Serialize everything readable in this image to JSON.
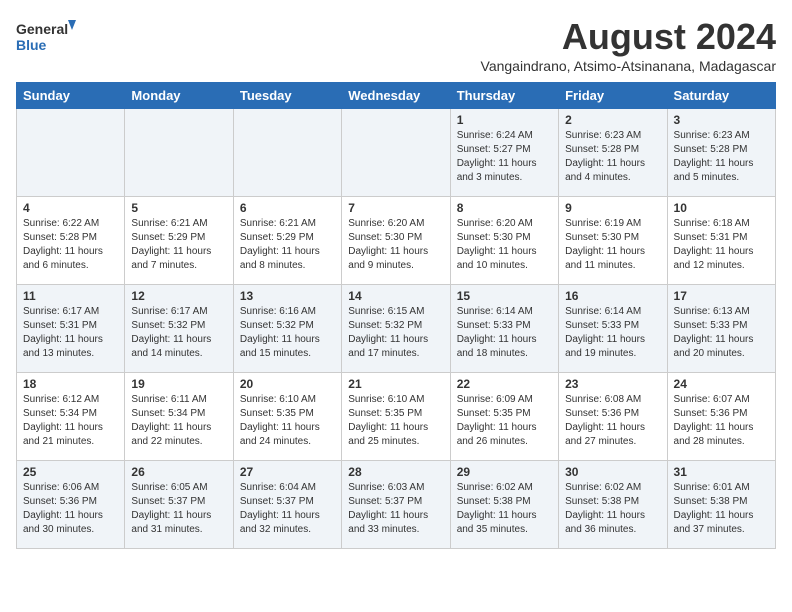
{
  "logo": {
    "general": "General",
    "blue": "Blue"
  },
  "header": {
    "month_year": "August 2024",
    "location": "Vangaindrano, Atsimo-Atsinanana, Madagascar"
  },
  "days_of_week": [
    "Sunday",
    "Monday",
    "Tuesday",
    "Wednesday",
    "Thursday",
    "Friday",
    "Saturday"
  ],
  "weeks": [
    [
      {
        "day": "",
        "sunrise": "",
        "sunset": "",
        "daylight": ""
      },
      {
        "day": "",
        "sunrise": "",
        "sunset": "",
        "daylight": ""
      },
      {
        "day": "",
        "sunrise": "",
        "sunset": "",
        "daylight": ""
      },
      {
        "day": "",
        "sunrise": "",
        "sunset": "",
        "daylight": ""
      },
      {
        "day": "1",
        "sunrise": "Sunrise: 6:24 AM",
        "sunset": "Sunset: 5:27 PM",
        "daylight": "Daylight: 11 hours and 3 minutes."
      },
      {
        "day": "2",
        "sunrise": "Sunrise: 6:23 AM",
        "sunset": "Sunset: 5:28 PM",
        "daylight": "Daylight: 11 hours and 4 minutes."
      },
      {
        "day": "3",
        "sunrise": "Sunrise: 6:23 AM",
        "sunset": "Sunset: 5:28 PM",
        "daylight": "Daylight: 11 hours and 5 minutes."
      }
    ],
    [
      {
        "day": "4",
        "sunrise": "Sunrise: 6:22 AM",
        "sunset": "Sunset: 5:28 PM",
        "daylight": "Daylight: 11 hours and 6 minutes."
      },
      {
        "day": "5",
        "sunrise": "Sunrise: 6:21 AM",
        "sunset": "Sunset: 5:29 PM",
        "daylight": "Daylight: 11 hours and 7 minutes."
      },
      {
        "day": "6",
        "sunrise": "Sunrise: 6:21 AM",
        "sunset": "Sunset: 5:29 PM",
        "daylight": "Daylight: 11 hours and 8 minutes."
      },
      {
        "day": "7",
        "sunrise": "Sunrise: 6:20 AM",
        "sunset": "Sunset: 5:30 PM",
        "daylight": "Daylight: 11 hours and 9 minutes."
      },
      {
        "day": "8",
        "sunrise": "Sunrise: 6:20 AM",
        "sunset": "Sunset: 5:30 PM",
        "daylight": "Daylight: 11 hours and 10 minutes."
      },
      {
        "day": "9",
        "sunrise": "Sunrise: 6:19 AM",
        "sunset": "Sunset: 5:30 PM",
        "daylight": "Daylight: 11 hours and 11 minutes."
      },
      {
        "day": "10",
        "sunrise": "Sunrise: 6:18 AM",
        "sunset": "Sunset: 5:31 PM",
        "daylight": "Daylight: 11 hours and 12 minutes."
      }
    ],
    [
      {
        "day": "11",
        "sunrise": "Sunrise: 6:17 AM",
        "sunset": "Sunset: 5:31 PM",
        "daylight": "Daylight: 11 hours and 13 minutes."
      },
      {
        "day": "12",
        "sunrise": "Sunrise: 6:17 AM",
        "sunset": "Sunset: 5:32 PM",
        "daylight": "Daylight: 11 hours and 14 minutes."
      },
      {
        "day": "13",
        "sunrise": "Sunrise: 6:16 AM",
        "sunset": "Sunset: 5:32 PM",
        "daylight": "Daylight: 11 hours and 15 minutes."
      },
      {
        "day": "14",
        "sunrise": "Sunrise: 6:15 AM",
        "sunset": "Sunset: 5:32 PM",
        "daylight": "Daylight: 11 hours and 17 minutes."
      },
      {
        "day": "15",
        "sunrise": "Sunrise: 6:14 AM",
        "sunset": "Sunset: 5:33 PM",
        "daylight": "Daylight: 11 hours and 18 minutes."
      },
      {
        "day": "16",
        "sunrise": "Sunrise: 6:14 AM",
        "sunset": "Sunset: 5:33 PM",
        "daylight": "Daylight: 11 hours and 19 minutes."
      },
      {
        "day": "17",
        "sunrise": "Sunrise: 6:13 AM",
        "sunset": "Sunset: 5:33 PM",
        "daylight": "Daylight: 11 hours and 20 minutes."
      }
    ],
    [
      {
        "day": "18",
        "sunrise": "Sunrise: 6:12 AM",
        "sunset": "Sunset: 5:34 PM",
        "daylight": "Daylight: 11 hours and 21 minutes."
      },
      {
        "day": "19",
        "sunrise": "Sunrise: 6:11 AM",
        "sunset": "Sunset: 5:34 PM",
        "daylight": "Daylight: 11 hours and 22 minutes."
      },
      {
        "day": "20",
        "sunrise": "Sunrise: 6:10 AM",
        "sunset": "Sunset: 5:35 PM",
        "daylight": "Daylight: 11 hours and 24 minutes."
      },
      {
        "day": "21",
        "sunrise": "Sunrise: 6:10 AM",
        "sunset": "Sunset: 5:35 PM",
        "daylight": "Daylight: 11 hours and 25 minutes."
      },
      {
        "day": "22",
        "sunrise": "Sunrise: 6:09 AM",
        "sunset": "Sunset: 5:35 PM",
        "daylight": "Daylight: 11 hours and 26 minutes."
      },
      {
        "day": "23",
        "sunrise": "Sunrise: 6:08 AM",
        "sunset": "Sunset: 5:36 PM",
        "daylight": "Daylight: 11 hours and 27 minutes."
      },
      {
        "day": "24",
        "sunrise": "Sunrise: 6:07 AM",
        "sunset": "Sunset: 5:36 PM",
        "daylight": "Daylight: 11 hours and 28 minutes."
      }
    ],
    [
      {
        "day": "25",
        "sunrise": "Sunrise: 6:06 AM",
        "sunset": "Sunset: 5:36 PM",
        "daylight": "Daylight: 11 hours and 30 minutes."
      },
      {
        "day": "26",
        "sunrise": "Sunrise: 6:05 AM",
        "sunset": "Sunset: 5:37 PM",
        "daylight": "Daylight: 11 hours and 31 minutes."
      },
      {
        "day": "27",
        "sunrise": "Sunrise: 6:04 AM",
        "sunset": "Sunset: 5:37 PM",
        "daylight": "Daylight: 11 hours and 32 minutes."
      },
      {
        "day": "28",
        "sunrise": "Sunrise: 6:03 AM",
        "sunset": "Sunset: 5:37 PM",
        "daylight": "Daylight: 11 hours and 33 minutes."
      },
      {
        "day": "29",
        "sunrise": "Sunrise: 6:02 AM",
        "sunset": "Sunset: 5:38 PM",
        "daylight": "Daylight: 11 hours and 35 minutes."
      },
      {
        "day": "30",
        "sunrise": "Sunrise: 6:02 AM",
        "sunset": "Sunset: 5:38 PM",
        "daylight": "Daylight: 11 hours and 36 minutes."
      },
      {
        "day": "31",
        "sunrise": "Sunrise: 6:01 AM",
        "sunset": "Sunset: 5:38 PM",
        "daylight": "Daylight: 11 hours and 37 minutes."
      }
    ]
  ]
}
